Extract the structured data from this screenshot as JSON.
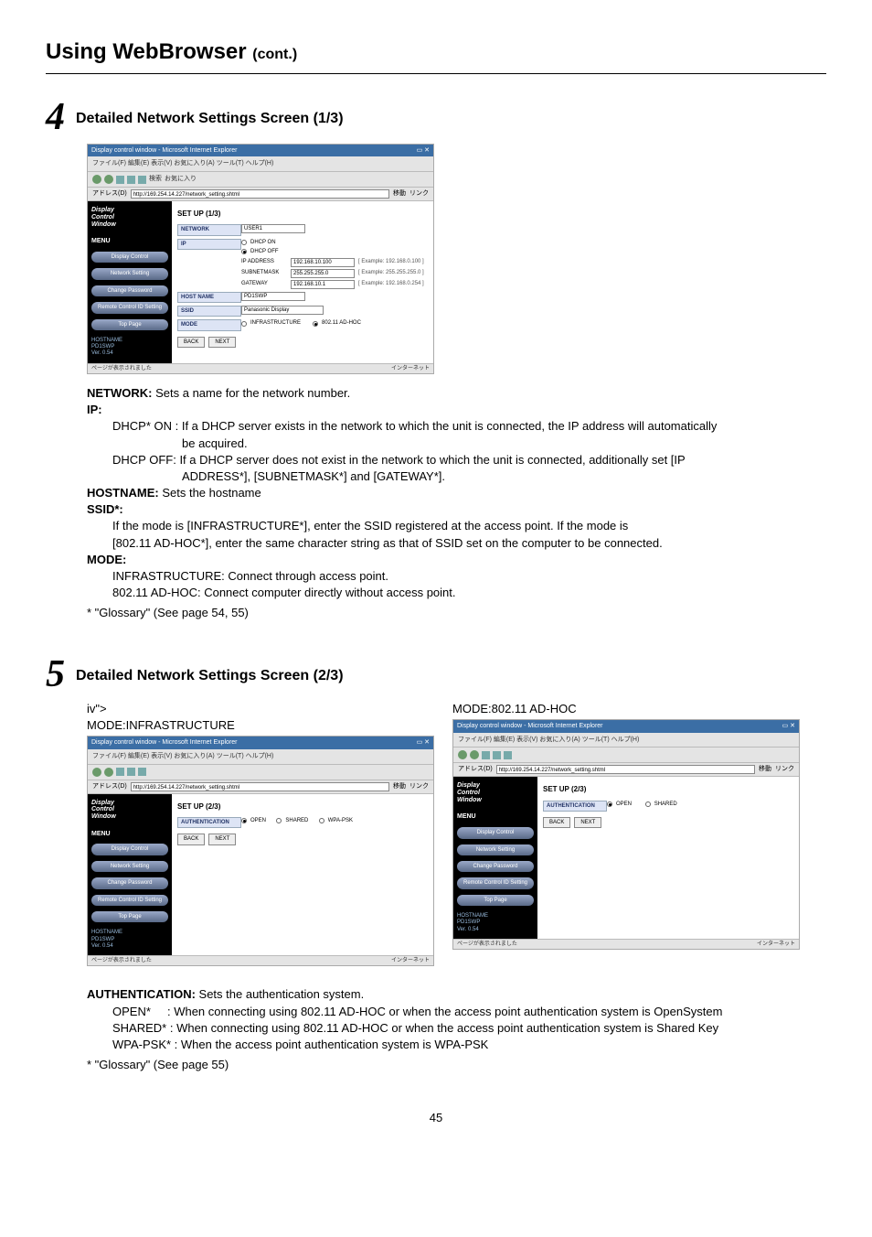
{
  "title_main": "Using WebBrowser",
  "title_cont": "(cont.)",
  "step4": {
    "num": "4",
    "heading": "Detailed Network Settings Screen (1/3)",
    "shot": {
      "window_title": "Display control window - Microsoft Internet Explorer",
      "menu": "ファイル(F)  編集(E)  表示(V)  お気に入り(A)  ツール(T)  ヘルプ(H)",
      "address_label": "アドレス(D)",
      "url": "http://169.254.14.227/network_setting.shtml",
      "go": "移動",
      "link": "リンク",
      "sidebar": {
        "dcw": "Display\nControl\nWindow",
        "menu": "MENU",
        "items": [
          "Display Control",
          "Network Setting",
          "Change Password",
          "Remote Control ID Setting",
          "Top Page"
        ],
        "host": [
          "HOSTNAME",
          "PD1SWP",
          "Ver. 0.54"
        ]
      },
      "subt": "SET UP (1/3)",
      "rows": {
        "network_label": "NETWORK",
        "network_value": "USER1",
        "ip_label": "IP",
        "dhcp_on": "DHCP ON",
        "dhcp_off": "DHCP OFF",
        "ipaddr_label": "IP ADDRESS",
        "ipaddr_value": "192.168.10.100",
        "ipaddr_hint": "[ Example: 192.168.0.100 ]",
        "subnet_label": "SUBNETMASK",
        "subnet_value": "255.255.255.0",
        "subnet_hint": "[ Example: 255.255.255.0 ]",
        "gateway_label": "GATEWAY",
        "gateway_value": "192.168.10.1",
        "gateway_hint": "[ Example: 192.168.0.254 ]",
        "hostname_label": "HOST NAME",
        "hostname_value": "PD1SWP",
        "ssid_label": "SSID",
        "ssid_value": "Panasonic Display",
        "mode_label": "MODE",
        "mode_infra": "INFRASTRUCTURE",
        "mode_adhoc": "802.11 AD-HOC"
      },
      "back": "BACK",
      "next": "NEXT",
      "status_left": "ページが表示されました",
      "status_right": "インターネット"
    },
    "desc": {
      "network_label": "NETWORK:",
      "network_text": "  Sets a name for the network number.",
      "ip_label": "IP:",
      "dhcp_on_lead": "DHCP* ON : ",
      "dhcp_on_l1": "If a DHCP server exists in the network to which the unit is connected, the IP address will automatically",
      "dhcp_on_l2": "be acquired.",
      "dhcp_off_lead": "DHCP OFF: ",
      "dhcp_off_l1": "If a DHCP server does not exist in the network to which the unit is connected, additionally set [IP",
      "dhcp_off_l2": "ADDRESS*], [SUBNETMASK*] and [GATEWAY*].",
      "hostname_label": "HOSTNAME:",
      "hostname_text": " Sets the hostname",
      "ssid_label": "SSID*:",
      "ssid_l1": "If the mode is [INFRASTRUCTURE*], enter the SSID registered at the access point. If the mode is",
      "ssid_l2": "[802.11 AD-HOC*], enter the same character string as that of SSID set on the computer to be connected.",
      "mode_label": "MODE:",
      "mode_infra_lead": "INFRASTRUCTURE:",
      "mode_infra_text": " Connect through access point.",
      "mode_adhoc_lead": "802.11 AD-HOC:",
      "mode_adhoc_text": " Connect computer directly without access point.",
      "glossary": "* \"Glossary\" (See page 54, 55)"
    }
  },
  "step5": {
    "num": "5",
    "heading": "Detailed Network Settings Screen (2/3)",
    "left_mode": "MODE:INFRASTRUCTURE",
    "right_mode": "MODE:802.11 AD-HOC",
    "shot_left": {
      "subt": "SET UP (2/3)",
      "auth_label": "AUTHENTICATION",
      "open": "OPEN",
      "shared": "SHARED",
      "wpapsk": "WPA-PSK"
    },
    "shot_right": {
      "subt": "SET UP (2/3)",
      "auth_label": "AUTHENTICATION",
      "open": "OPEN",
      "shared": "SHARED"
    },
    "desc": {
      "auth_label": "AUTHENTICATION:",
      "auth_text": " Sets the authentication system.",
      "open_lead": "OPEN*",
      "open_text": " : When connecting using 802.11 AD-HOC or when the access point authentication system is OpenSystem",
      "shared_lead": "SHARED* :",
      "shared_text": " When connecting using 802.11 AD-HOC or when the access point authentication system is Shared Key",
      "wpa_lead": "WPA-PSK* :",
      "wpa_text": " When the access point authentication system is WPA-PSK",
      "glossary": "* \"Glossary\" (See page 55)"
    }
  },
  "pagenum": "45"
}
